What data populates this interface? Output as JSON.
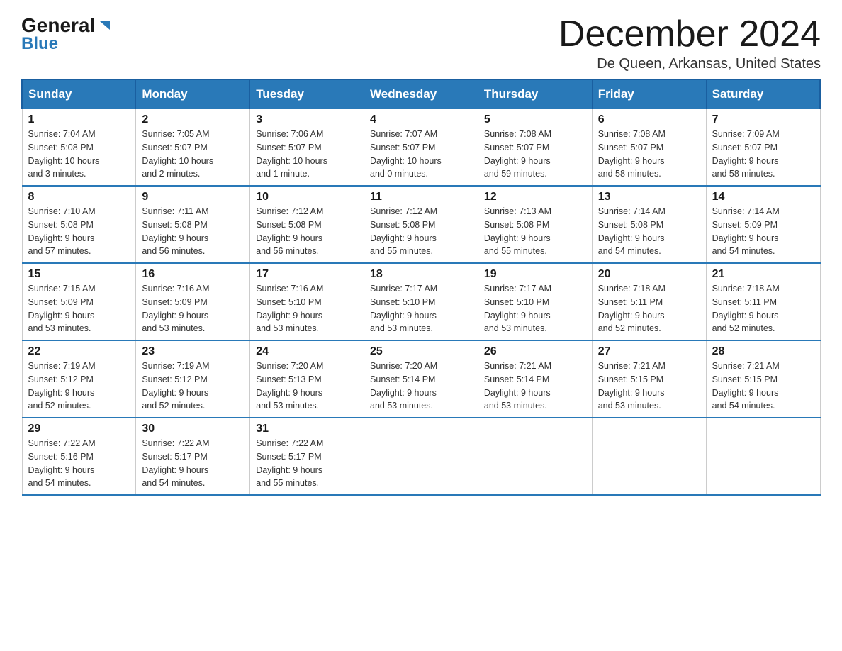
{
  "logo": {
    "general": "General",
    "blue": "Blue"
  },
  "title": {
    "month_year": "December 2024",
    "location": "De Queen, Arkansas, United States"
  },
  "days_of_week": [
    "Sunday",
    "Monday",
    "Tuesday",
    "Wednesday",
    "Thursday",
    "Friday",
    "Saturday"
  ],
  "weeks": [
    [
      {
        "day": "1",
        "sunrise": "7:04 AM",
        "sunset": "5:08 PM",
        "daylight": "10 hours",
        "daylight2": "and 3 minutes."
      },
      {
        "day": "2",
        "sunrise": "7:05 AM",
        "sunset": "5:07 PM",
        "daylight": "10 hours",
        "daylight2": "and 2 minutes."
      },
      {
        "day": "3",
        "sunrise": "7:06 AM",
        "sunset": "5:07 PM",
        "daylight": "10 hours",
        "daylight2": "and 1 minute."
      },
      {
        "day": "4",
        "sunrise": "7:07 AM",
        "sunset": "5:07 PM",
        "daylight": "10 hours",
        "daylight2": "and 0 minutes."
      },
      {
        "day": "5",
        "sunrise": "7:08 AM",
        "sunset": "5:07 PM",
        "daylight": "9 hours",
        "daylight2": "and 59 minutes."
      },
      {
        "day": "6",
        "sunrise": "7:08 AM",
        "sunset": "5:07 PM",
        "daylight": "9 hours",
        "daylight2": "and 58 minutes."
      },
      {
        "day": "7",
        "sunrise": "7:09 AM",
        "sunset": "5:07 PM",
        "daylight": "9 hours",
        "daylight2": "and 58 minutes."
      }
    ],
    [
      {
        "day": "8",
        "sunrise": "7:10 AM",
        "sunset": "5:08 PM",
        "daylight": "9 hours",
        "daylight2": "and 57 minutes."
      },
      {
        "day": "9",
        "sunrise": "7:11 AM",
        "sunset": "5:08 PM",
        "daylight": "9 hours",
        "daylight2": "and 56 minutes."
      },
      {
        "day": "10",
        "sunrise": "7:12 AM",
        "sunset": "5:08 PM",
        "daylight": "9 hours",
        "daylight2": "and 56 minutes."
      },
      {
        "day": "11",
        "sunrise": "7:12 AM",
        "sunset": "5:08 PM",
        "daylight": "9 hours",
        "daylight2": "and 55 minutes."
      },
      {
        "day": "12",
        "sunrise": "7:13 AM",
        "sunset": "5:08 PM",
        "daylight": "9 hours",
        "daylight2": "and 55 minutes."
      },
      {
        "day": "13",
        "sunrise": "7:14 AM",
        "sunset": "5:08 PM",
        "daylight": "9 hours",
        "daylight2": "and 54 minutes."
      },
      {
        "day": "14",
        "sunrise": "7:14 AM",
        "sunset": "5:09 PM",
        "daylight": "9 hours",
        "daylight2": "and 54 minutes."
      }
    ],
    [
      {
        "day": "15",
        "sunrise": "7:15 AM",
        "sunset": "5:09 PM",
        "daylight": "9 hours",
        "daylight2": "and 53 minutes."
      },
      {
        "day": "16",
        "sunrise": "7:16 AM",
        "sunset": "5:09 PM",
        "daylight": "9 hours",
        "daylight2": "and 53 minutes."
      },
      {
        "day": "17",
        "sunrise": "7:16 AM",
        "sunset": "5:10 PM",
        "daylight": "9 hours",
        "daylight2": "and 53 minutes."
      },
      {
        "day": "18",
        "sunrise": "7:17 AM",
        "sunset": "5:10 PM",
        "daylight": "9 hours",
        "daylight2": "and 53 minutes."
      },
      {
        "day": "19",
        "sunrise": "7:17 AM",
        "sunset": "5:10 PM",
        "daylight": "9 hours",
        "daylight2": "and 53 minutes."
      },
      {
        "day": "20",
        "sunrise": "7:18 AM",
        "sunset": "5:11 PM",
        "daylight": "9 hours",
        "daylight2": "and 52 minutes."
      },
      {
        "day": "21",
        "sunrise": "7:18 AM",
        "sunset": "5:11 PM",
        "daylight": "9 hours",
        "daylight2": "and 52 minutes."
      }
    ],
    [
      {
        "day": "22",
        "sunrise": "7:19 AM",
        "sunset": "5:12 PM",
        "daylight": "9 hours",
        "daylight2": "and 52 minutes."
      },
      {
        "day": "23",
        "sunrise": "7:19 AM",
        "sunset": "5:12 PM",
        "daylight": "9 hours",
        "daylight2": "and 52 minutes."
      },
      {
        "day": "24",
        "sunrise": "7:20 AM",
        "sunset": "5:13 PM",
        "daylight": "9 hours",
        "daylight2": "and 53 minutes."
      },
      {
        "day": "25",
        "sunrise": "7:20 AM",
        "sunset": "5:14 PM",
        "daylight": "9 hours",
        "daylight2": "and 53 minutes."
      },
      {
        "day": "26",
        "sunrise": "7:21 AM",
        "sunset": "5:14 PM",
        "daylight": "9 hours",
        "daylight2": "and 53 minutes."
      },
      {
        "day": "27",
        "sunrise": "7:21 AM",
        "sunset": "5:15 PM",
        "daylight": "9 hours",
        "daylight2": "and 53 minutes."
      },
      {
        "day": "28",
        "sunrise": "7:21 AM",
        "sunset": "5:15 PM",
        "daylight": "9 hours",
        "daylight2": "and 54 minutes."
      }
    ],
    [
      {
        "day": "29",
        "sunrise": "7:22 AM",
        "sunset": "5:16 PM",
        "daylight": "9 hours",
        "daylight2": "and 54 minutes."
      },
      {
        "day": "30",
        "sunrise": "7:22 AM",
        "sunset": "5:17 PM",
        "daylight": "9 hours",
        "daylight2": "and 54 minutes."
      },
      {
        "day": "31",
        "sunrise": "7:22 AM",
        "sunset": "5:17 PM",
        "daylight": "9 hours",
        "daylight2": "and 55 minutes."
      },
      null,
      null,
      null,
      null
    ]
  ]
}
